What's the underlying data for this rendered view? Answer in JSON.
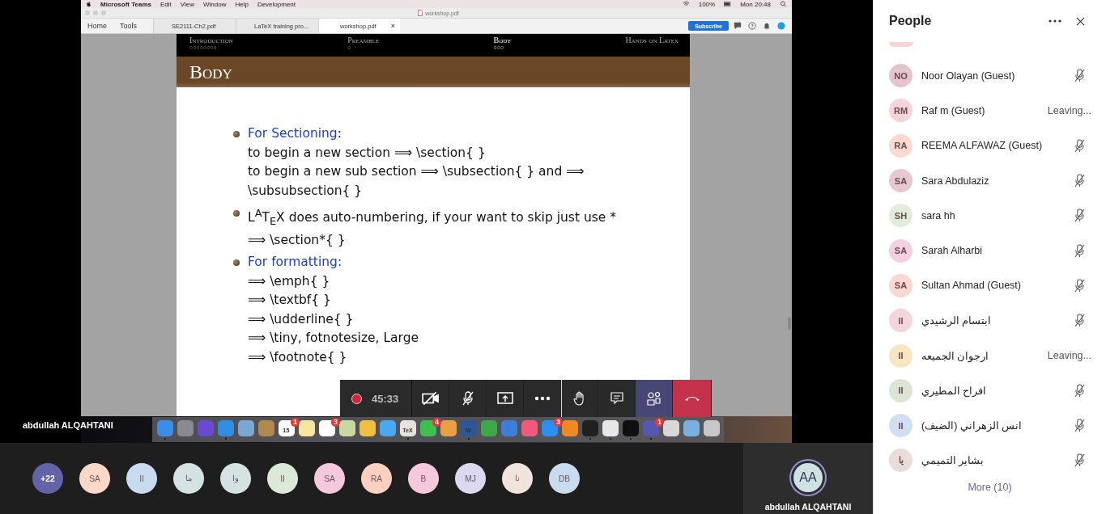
{
  "mac_menu_bar": {
    "app": "Microsoft Teams",
    "menus": [
      "Edit",
      "View",
      "Window",
      "Help",
      "Development"
    ],
    "battery": "100%",
    "clock": "Mon 20:48"
  },
  "pdf_window": {
    "title": "workshop.pdf",
    "nav": [
      "Home",
      "Tools"
    ],
    "tabs": [
      {
        "label": "SE2111-Ch2.pdf",
        "selected": false
      },
      {
        "label": "LaTeX training pro...",
        "selected": false
      },
      {
        "label": "workshop.pdf",
        "selected": true,
        "close": "×"
      }
    ],
    "subscribe": "Subscribe"
  },
  "slide": {
    "sections": [
      {
        "label": "Introduction",
        "dots": "○○○○○○○○",
        "selected": false
      },
      {
        "label": "Preamble",
        "dots": "○",
        "selected": false
      },
      {
        "label": "Body",
        "dots": "○○○",
        "selected": true
      },
      {
        "label": "Hands on Latex",
        "selected": false
      }
    ],
    "title": "Body",
    "bullets": [
      {
        "heading": "For Sectioning",
        "after_heading": ":",
        "lines": [
          "to begin a new section ⟹ \\section{ }",
          "to begin a new sub section ⟹ \\subsection{ } and ⟹",
          "\\subsubsection{ }"
        ]
      },
      {
        "lines": [
          "L$^{A}$T$_{E}$X does auto-numbering, if your want to skip just use *",
          "⟹ \\section*{ }"
        ]
      },
      {
        "heading": "For formatting:",
        "lines": [
          "⟹ \\emph{ }",
          "⟹ \\textbf{ }",
          "⟹ \\udderline{ }",
          "⟹ \\tiny, fotnotesize, Large",
          "⟹ \\footnote{ }"
        ]
      }
    ]
  },
  "call_toolbar": {
    "recording": true,
    "timer": "45:33",
    "camera_on": false,
    "mic_on": false,
    "people_selected": true
  },
  "presenter_name": "abdullah ALQAHTANI",
  "dock": {
    "items": [
      {
        "color": "#3a8ee6",
        "running": true
      },
      {
        "color": "#8a8a90",
        "running": false
      },
      {
        "color": "#6a4bd0",
        "running": false
      },
      {
        "color": "#2f8de4",
        "running": true
      },
      {
        "color": "#7aa8d0",
        "running": false
      },
      {
        "color": "#b08850",
        "running": false
      },
      {
        "color": "#ffffff",
        "label": "15",
        "badge": "1",
        "running": false
      },
      {
        "color": "#f5e6a0",
        "running": false
      },
      {
        "color": "#ffffff",
        "badge": "3",
        "running": false
      },
      {
        "color": "#c8d8a0",
        "running": false
      },
      {
        "color": "#f0c040",
        "running": false
      },
      {
        "color": "#4aa8f0",
        "running": false
      },
      {
        "color": "#e8e4dc",
        "label": "TeX",
        "running": true
      },
      {
        "color": "#3cc050",
        "badge": "4",
        "running": false
      },
      {
        "color": "#e8a040",
        "running": false
      },
      {
        "color": "#2b579a",
        "label": "W",
        "running": true
      },
      {
        "color": "#3fa84a",
        "running": false
      },
      {
        "color": "#3b7fd8",
        "running": false
      },
      {
        "color": "#f05a7a",
        "running": false
      },
      {
        "color": "#2a8ff0",
        "badge": "3",
        "running": false
      },
      {
        "color": "#f08a20",
        "running": false
      },
      {
        "color": "#202020",
        "running": true
      },
      {
        "color": "#e8e8e8",
        "running": true
      },
      {
        "color": "#101010",
        "running": true
      },
      {
        "color": "#5558af",
        "badge": "1",
        "running": true
      },
      {
        "color": "#d8d8d8",
        "running": false
      },
      {
        "color": "#7ab0e0",
        "running": false
      },
      {
        "color": "#c8c8c8",
        "running": false
      }
    ]
  },
  "gallery": {
    "participants": [
      {
        "initials": "+22",
        "kind": "overflow",
        "color": "#6264a7"
      },
      {
        "initials": "SA",
        "kind": "person",
        "color": "#fbd8c8"
      },
      {
        "initials": "II",
        "kind": "person",
        "color": "#c8dcf0"
      },
      {
        "initials": "ما",
        "kind": "person",
        "color": "#d4e2e2"
      },
      {
        "initials": "وا",
        "kind": "person",
        "color": "#d4e2e2"
      },
      {
        "initials": "II",
        "kind": "person",
        "color": "#dce8d8"
      },
      {
        "initials": "SA",
        "kind": "person",
        "color": "#f5c8dc"
      },
      {
        "initials": "RA",
        "kind": "person",
        "color": "#fbd0c0"
      },
      {
        "initials": "B",
        "kind": "person",
        "color": "#f5c8dc"
      },
      {
        "initials": "MJ",
        "kind": "person",
        "color": "#dcd8f0"
      },
      {
        "initials": "نا",
        "kind": "person",
        "color": "#f0e4dc"
      },
      {
        "initials": "DB",
        "kind": "person",
        "color": "#c8dcf0"
      }
    ],
    "self": {
      "initials": "AA",
      "name": "abdullah ALQAHTANI"
    }
  },
  "people_panel": {
    "title": "People",
    "rows": [
      {
        "initials": "NO",
        "name": "Noor Olayan (Guest)",
        "color": "#e6c4cc",
        "kind": "muted"
      },
      {
        "initials": "RM",
        "name": "Raf m (Guest)",
        "color": "#f6d4d8",
        "kind": "leaving",
        "status": "Leaving..."
      },
      {
        "initials": "RA",
        "name": "REEMA ALFAWAZ (Guest)",
        "color": "#fbd8d0",
        "kind": "muted"
      },
      {
        "initials": "SA",
        "name": "Sara Abdulaziz",
        "color": "#e6c8d0",
        "kind": "muted"
      },
      {
        "initials": "SH",
        "name": "sara hh",
        "color": "#e2ecdc",
        "kind": "muted"
      },
      {
        "initials": "SA",
        "name": "Sarah Alharbi",
        "color": "#f5d0e2",
        "kind": "muted"
      },
      {
        "initials": "SA",
        "name": "Sultan Ahmad (Guest)",
        "color": "#fbd8d0",
        "kind": "muted"
      },
      {
        "initials": "II",
        "name": "ابتسام الرشيدي",
        "color": "#f5d5dc",
        "kind": "muted"
      },
      {
        "initials": "II",
        "name": "ارجوان الجميعه",
        "color": "#f8e6c0",
        "kind": "leaving",
        "status": "Leaving..."
      },
      {
        "initials": "II",
        "name": "افراح المطيري",
        "color": "#dce4d4",
        "kind": "muted"
      },
      {
        "initials": "II",
        "name": "انس الزهراني (الضيف)",
        "color": "#d0e0f2",
        "kind": "muted"
      },
      {
        "initials": "يا",
        "name": "بشاير التميمي",
        "color": "#eadcd8",
        "kind": "muted"
      }
    ],
    "more": "More (10)"
  }
}
